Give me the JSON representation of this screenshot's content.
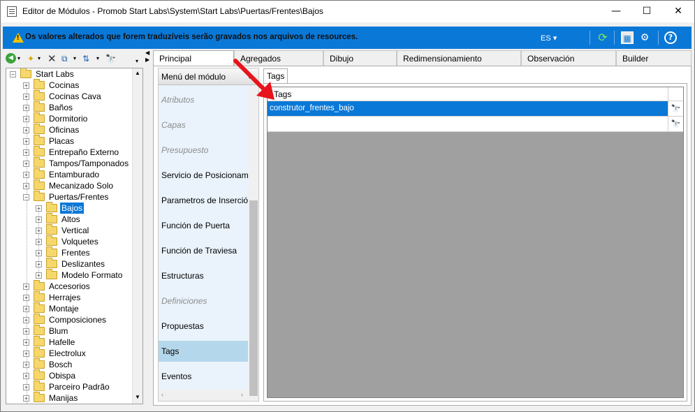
{
  "window": {
    "title": "Editor de Módulos - Promob Start Labs\\System\\Start Labs\\Puertas/Frentes\\Bajos",
    "minimize_glyph": "—",
    "maximize_glyph": "☐",
    "close_glyph": "✕"
  },
  "infobar": {
    "message": "Os valores alterados que forem traduzíveis serão gravados nos arquivos de resources.",
    "language": "ES",
    "language_arrow": "▾"
  },
  "toolbar": {
    "back_glyph": "◀",
    "new_glyph": "✦",
    "delete_glyph": "✕",
    "copy_glyph": "⧉",
    "sort_glyph": "⇅",
    "find_glyph": "🔭",
    "refresh_glyph": "⟳",
    "view_glyph": "▦",
    "settings_glyph": "⚙",
    "help_glyph": "?"
  },
  "tree": {
    "items": [
      {
        "label": "Start Labs"
      },
      {
        "label": "Cocinas"
      },
      {
        "label": "Cocinas Cava"
      },
      {
        "label": "Baños"
      },
      {
        "label": "Dormitorio"
      },
      {
        "label": "Oficinas"
      },
      {
        "label": "Placas"
      },
      {
        "label": "Entrepaño Externo"
      },
      {
        "label": "Tampos/Tamponados"
      },
      {
        "label": "Entamburado"
      },
      {
        "label": "Mecanizado Solo"
      },
      {
        "label": "Puertas/Frentes"
      },
      {
        "label": "Bajos"
      },
      {
        "label": "Altos"
      },
      {
        "label": "Vertical"
      },
      {
        "label": "Volquetes"
      },
      {
        "label": "Frentes"
      },
      {
        "label": "Deslizantes"
      },
      {
        "label": "Modelo Formato"
      },
      {
        "label": "Accesorios"
      },
      {
        "label": "Herrajes"
      },
      {
        "label": "Montaje"
      },
      {
        "label": "Composiciones"
      },
      {
        "label": "Blum"
      },
      {
        "label": "Hafelle"
      },
      {
        "label": "Electrolux"
      },
      {
        "label": "Bosch"
      },
      {
        "label": "Obispa"
      },
      {
        "label": "Parceiro Padrão"
      },
      {
        "label": "Manijas"
      }
    ]
  },
  "tabs": [
    {
      "label": "Principal"
    },
    {
      "label": "Agregados"
    },
    {
      "label": "Dibujo"
    },
    {
      "label": "Redimensionamiento"
    },
    {
      "label": "Observación"
    },
    {
      "label": "Builder"
    }
  ],
  "module_menu": {
    "header": "Menú del módulo",
    "items": [
      {
        "label": "Atributos"
      },
      {
        "label": "Capas"
      },
      {
        "label": "Presupuesto"
      },
      {
        "label": "Servicio de Posicionamiento"
      },
      {
        "label": "Parametros de Inserción"
      },
      {
        "label": "Función de Puerta"
      },
      {
        "label": "Función de Traviesa"
      },
      {
        "label": "Estructuras"
      },
      {
        "label": "Definiciones"
      },
      {
        "label": "Propuestas"
      },
      {
        "label": "Tags"
      },
      {
        "label": "Eventos"
      }
    ]
  },
  "tags_panel": {
    "tab_label": "Tags",
    "column_header": "Tags",
    "rows": [
      {
        "value": "construtor_frentes_bajo"
      },
      {
        "value": ""
      }
    ]
  },
  "colors": {
    "accent": "#0a78d7",
    "menu_bg": "#eaf3fb",
    "menu_selected": "#b4d7eb",
    "annotation_arrow": "#e8141c"
  }
}
